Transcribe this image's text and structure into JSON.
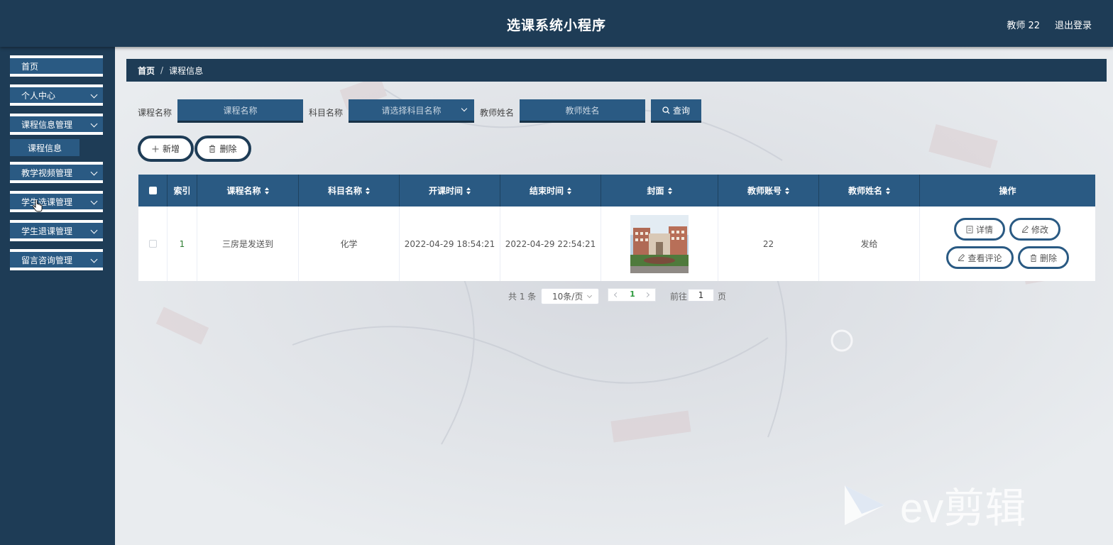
{
  "header": {
    "title": "选课系统小程序",
    "user": "教师 22",
    "logout": "退出登录"
  },
  "sidebar": {
    "items": [
      {
        "label": "首页"
      },
      {
        "label": "个人中心"
      },
      {
        "label": "课程信息管理"
      },
      {
        "label": "教学视频管理"
      },
      {
        "label": "学生选课管理"
      },
      {
        "label": "学生退课管理"
      },
      {
        "label": "留言咨询管理"
      }
    ],
    "sub_item": "课程信息"
  },
  "breadcrumb": {
    "home": "首页",
    "separator": "/",
    "current": "课程信息"
  },
  "search": {
    "course_label": "课程名称",
    "course_placeholder": "课程名称",
    "subject_label": "科目名称",
    "subject_placeholder": "请选择科目名称",
    "teacher_label": "教师姓名",
    "teacher_placeholder": "教师姓名",
    "query_label": "查询"
  },
  "actions": {
    "add": "新增",
    "delete": "删除"
  },
  "table": {
    "columns": [
      "索引",
      "课程名称",
      "科目名称",
      "开课时间",
      "结束时间",
      "封面",
      "教师账号",
      "教师姓名",
      "操作"
    ],
    "rows": [
      {
        "index": "1",
        "course_name": "三房是发送到",
        "subject": "化学",
        "start_time": "2022-04-29 18:54:21",
        "end_time": "2022-04-29 22:54:21",
        "teacher_account": "22",
        "teacher_name": "发给"
      }
    ],
    "row_actions": {
      "detail": "详情",
      "edit": "修改",
      "comments": "查看评论",
      "delete": "删除"
    }
  },
  "pagination": {
    "total": "共 1 条",
    "page_size": "10条/页",
    "current_page": "1",
    "goto_label": "前往",
    "goto_value": "1",
    "goto_suffix": "页"
  },
  "watermark": "ev剪辑",
  "colors": {
    "primary": "#2a5a83",
    "dark": "#1e3c56",
    "index_green": "#2e7d32"
  }
}
